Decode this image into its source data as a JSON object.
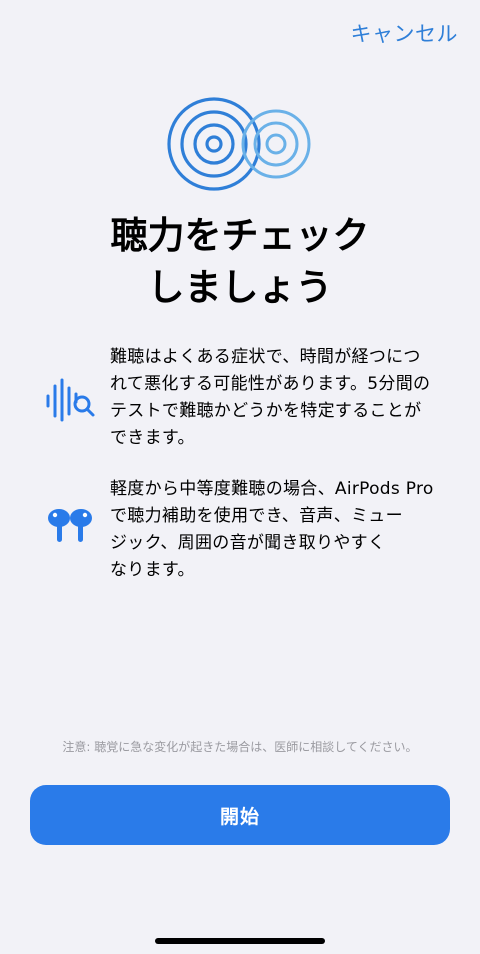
{
  "header": {
    "cancel_label": "キャンセル"
  },
  "hero": {
    "icon": "hearing-rings-icon",
    "title_line1": "聴力をチェック",
    "title_line2": "しましょう"
  },
  "features": [
    {
      "icon": "waveform-magnifier-icon",
      "text_lines": [
        "難聴はよくある症状で、時間が経つにつ",
        "れて悪化する可能性があります。5分間の",
        "テストで難聴かどうかを特定することが",
        "できます。"
      ]
    },
    {
      "icon": "airpods-pro-icon",
      "text_lines": [
        "軽度から中等度難聴の場合、AirPods Pro",
        "で聴力補助を使用でき、音声、ミュー",
        "ジック、周囲の音が聞き取りやすく",
        "なります。"
      ]
    }
  ],
  "disclaimer": "注意: 聴覚に急な変化が起きた場合は、医師に相談してください。",
  "start_button_label": "開始",
  "colors": {
    "accent": "#2a7be9",
    "link": "#2f7fd8",
    "background": "#f2f2f7",
    "secondary_text": "#9a9aa0"
  }
}
